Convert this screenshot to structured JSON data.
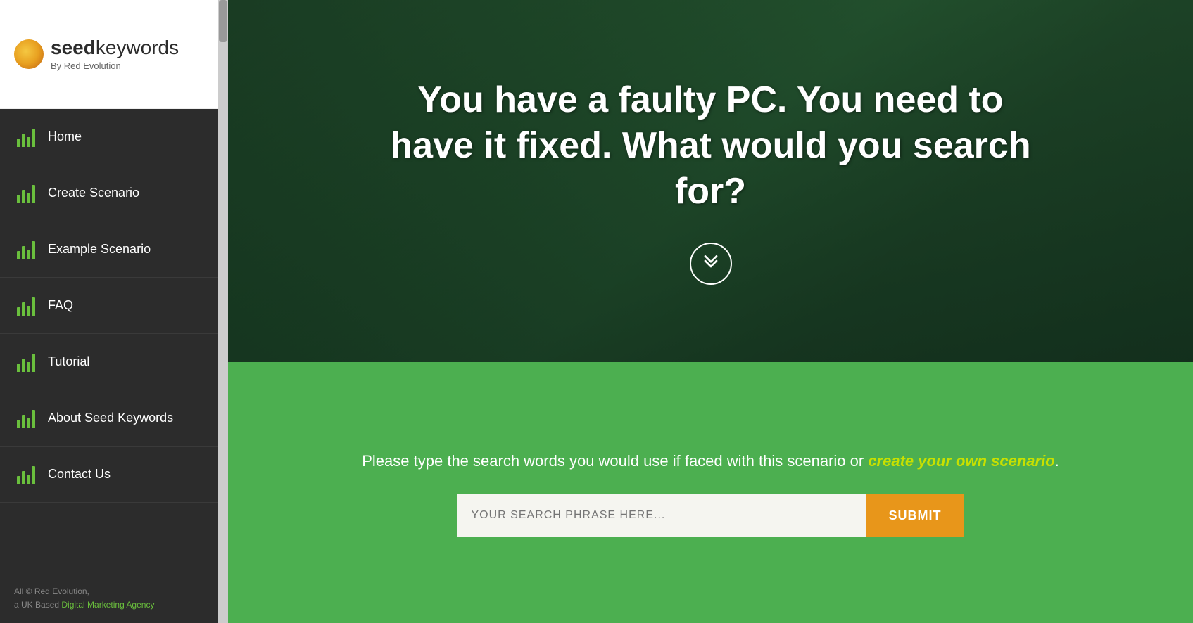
{
  "sidebar": {
    "logo": {
      "brand_bold": "seed",
      "brand_light": "keywords",
      "sub": "By Red Evolution"
    },
    "nav_items": [
      {
        "id": "home",
        "label": "Home",
        "bars": [
          3,
          5,
          4,
          7
        ]
      },
      {
        "id": "create-scenario",
        "label": "Create Scenario",
        "bars": [
          3,
          5,
          4,
          7
        ]
      },
      {
        "id": "example-scenario",
        "label": "Example Scenario",
        "bars": [
          3,
          5,
          4,
          7
        ]
      },
      {
        "id": "faq",
        "label": "FAQ",
        "bars": [
          3,
          5,
          4,
          7
        ]
      },
      {
        "id": "tutorial",
        "label": "Tutorial",
        "bars": [
          3,
          5,
          4,
          7
        ]
      },
      {
        "id": "about-seed-keywords",
        "label": "About Seed Keywords",
        "bars": [
          3,
          5,
          4,
          7
        ]
      },
      {
        "id": "contact-us",
        "label": "Contact Us",
        "bars": [
          3,
          5,
          4,
          7
        ]
      }
    ],
    "footer_line1": "All © Red Evolution,",
    "footer_line2": "a UK Based ",
    "footer_link_text": "Digital Marketing Agency",
    "footer_link_href": "#"
  },
  "hero": {
    "title": "You have a faulty PC. You need to have it fixed. What would you search for?",
    "scroll_icon_label": "scroll-down"
  },
  "green_section": {
    "description_before": "Please type the search words you would use if faced with this scenario or ",
    "description_link": "create your own scenario",
    "description_after": ".",
    "search_placeholder": "YOUR SEARCH PHRASE HERE...",
    "submit_label": "SUBMIT"
  }
}
